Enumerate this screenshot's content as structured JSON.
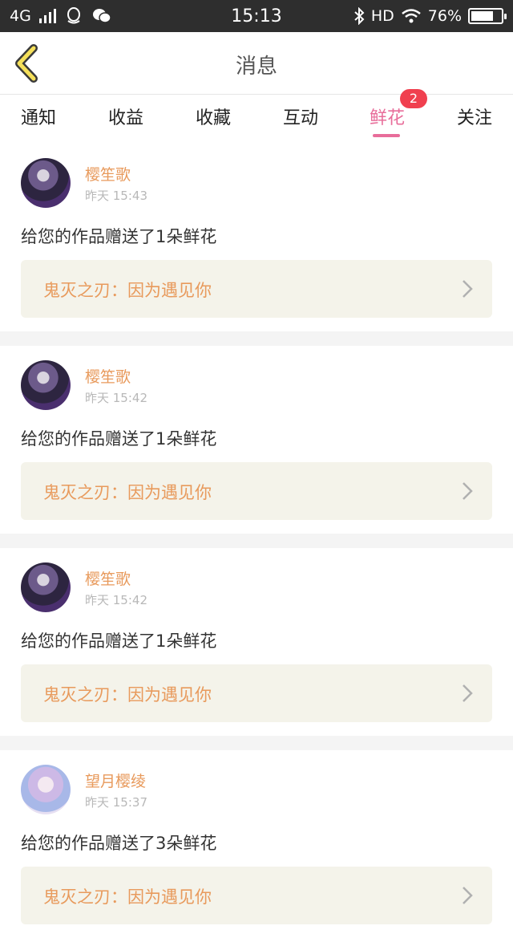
{
  "status_bar": {
    "network": "4G",
    "time": "15:13",
    "hd": "HD",
    "battery_percent": "76%",
    "battery_level": 0.76,
    "icons": [
      "qq-icon",
      "wechat-icon",
      "bluetooth-icon",
      "wifi-icon",
      "battery-icon"
    ]
  },
  "header": {
    "title": "消息",
    "back_icon": "chevron-left-icon",
    "accent_color": "#f5e05a"
  },
  "tabs": [
    {
      "label": "通知"
    },
    {
      "label": "收益"
    },
    {
      "label": "收藏"
    },
    {
      "label": "互动"
    },
    {
      "label": "鲜花",
      "badge": "2",
      "active": true
    },
    {
      "label": "关注"
    }
  ],
  "colors": {
    "active_tab": "#e86d9a",
    "badge": "#f0404f",
    "username": "#e89a5c",
    "link_bg": "#f4f3ea"
  },
  "messages": [
    {
      "user": "樱笙歌",
      "time": "昨天 15:43",
      "text": "给您的作品赠送了1朵鲜花",
      "work": "鬼灭之刃：因为遇见你"
    },
    {
      "user": "樱笙歌",
      "time": "昨天 15:42",
      "text": "给您的作品赠送了1朵鲜花",
      "work": "鬼灭之刃：因为遇见你"
    },
    {
      "user": "樱笙歌",
      "time": "昨天 15:42",
      "text": "给您的作品赠送了1朵鲜花",
      "work": "鬼灭之刃：因为遇见你"
    },
    {
      "user": "望月樱绫",
      "time": "昨天 15:37",
      "text": "给您的作品赠送了3朵鲜花",
      "work": "鬼灭之刃：因为遇见你"
    }
  ]
}
